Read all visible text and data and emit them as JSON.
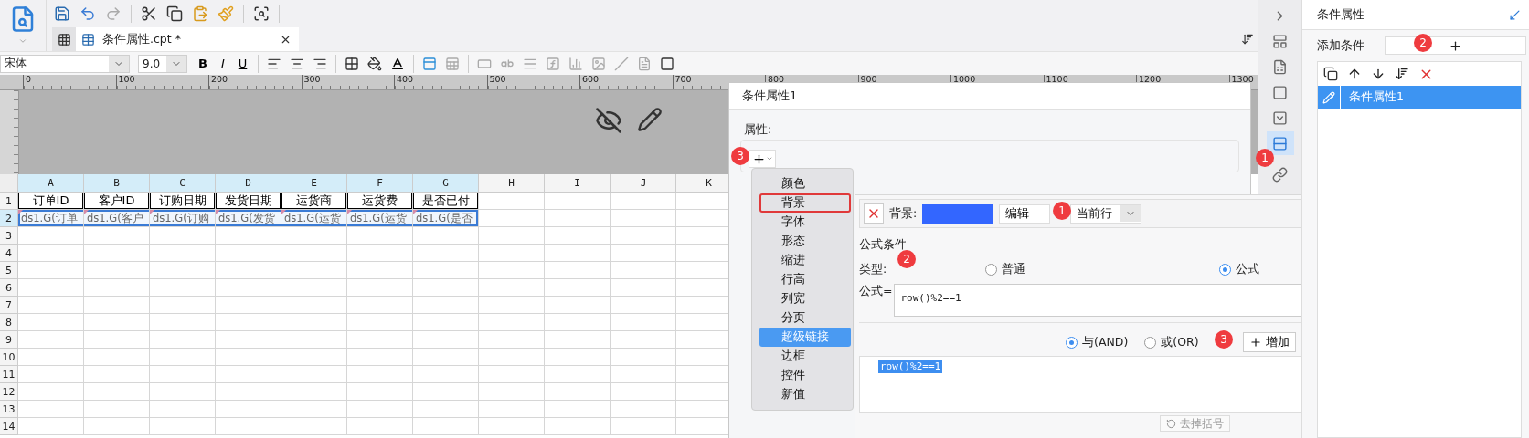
{
  "tab_bar": {
    "tabs": [
      {
        "label": "条件属性.cpt *",
        "selected": true
      }
    ]
  },
  "format_toolbar": {
    "font": "宋体",
    "size": "9.0",
    "style_buttons": [
      "B",
      "I",
      "U"
    ]
  },
  "ruler": {
    "labels": [
      "0",
      "100",
      "200",
      "300",
      "400",
      "500",
      "600",
      "700",
      "800",
      "900",
      "1000",
      "1100",
      "1200",
      "1300"
    ]
  },
  "sheet": {
    "columns": [
      {
        "label": "A",
        "selected": true,
        "page_break": false
      },
      {
        "label": "B",
        "selected": true,
        "page_break": false
      },
      {
        "label": "C",
        "selected": true,
        "page_break": false
      },
      {
        "label": "D",
        "selected": true,
        "page_break": false
      },
      {
        "label": "E",
        "selected": true,
        "page_break": false
      },
      {
        "label": "F",
        "selected": true,
        "page_break": false
      },
      {
        "label": "G",
        "selected": true,
        "page_break": false
      },
      {
        "label": "H",
        "selected": false,
        "page_break": false
      },
      {
        "label": "I",
        "selected": false,
        "page_break": false
      },
      {
        "label": "J",
        "selected": false,
        "page_break": true
      },
      {
        "label": "K",
        "selected": false,
        "page_break": false
      }
    ],
    "rows": [
      {
        "number": "1",
        "kind": "header",
        "selected": false,
        "cells": [
          "订单ID",
          "客户ID",
          "订购日期",
          "发货日期",
          "运货商",
          "运货费",
          "是否已付"
        ]
      },
      {
        "number": "2",
        "kind": "field",
        "selected": true,
        "cells": [
          "ds1.G(订单",
          "ds1.G(客户",
          "ds1.G(订购",
          "ds1.G(发货",
          "ds1.G(运货",
          "ds1.G(运货",
          "ds1.G(是否"
        ]
      },
      {
        "number": "3",
        "kind": "empty",
        "selected": false
      },
      {
        "number": "4",
        "kind": "empty",
        "selected": false
      },
      {
        "number": "5",
        "kind": "empty",
        "selected": false
      },
      {
        "number": "6",
        "kind": "empty",
        "selected": false
      },
      {
        "number": "7",
        "kind": "empty",
        "selected": false
      },
      {
        "number": "8",
        "kind": "empty",
        "selected": false
      },
      {
        "number": "9",
        "kind": "empty",
        "selected": false
      },
      {
        "number": "10",
        "kind": "empty",
        "selected": false
      },
      {
        "number": "11",
        "kind": "empty",
        "selected": false
      },
      {
        "number": "12",
        "kind": "empty",
        "selected": false
      },
      {
        "number": "13",
        "kind": "empty",
        "selected": false
      },
      {
        "number": "14",
        "kind": "empty",
        "selected": false
      }
    ]
  },
  "dialog": {
    "title": "条件属性1",
    "section_label": "属性:",
    "badge": "3"
  },
  "add_menu": {
    "items": [
      {
        "label": "颜色",
        "selected": false,
        "outlined": false
      },
      {
        "label": "背景",
        "selected": false,
        "outlined": true
      },
      {
        "label": "字体",
        "selected": false,
        "outlined": false
      },
      {
        "label": "形态",
        "selected": false,
        "outlined": false
      },
      {
        "label": "缩进",
        "selected": false,
        "outlined": false
      },
      {
        "label": "行高",
        "selected": false,
        "outlined": false
      },
      {
        "label": "列宽",
        "selected": false,
        "outlined": false
      },
      {
        "label": "分页",
        "selected": false,
        "outlined": false
      },
      {
        "label": "超级链接",
        "selected": true,
        "outlined": false
      },
      {
        "label": "边框",
        "selected": false,
        "outlined": false
      },
      {
        "label": "控件",
        "selected": false,
        "outlined": false
      },
      {
        "label": "新值",
        "selected": false,
        "outlined": false
      }
    ]
  },
  "condition_editor": {
    "label": "背景:",
    "color": "#3366ff",
    "edit_button": "编辑",
    "edit_badge": "1",
    "scope": "当前行",
    "section": "公式条件",
    "type_label": "类型:",
    "type_badge": "2",
    "types": [
      {
        "label": "普通",
        "selected": false
      },
      {
        "label": "公式",
        "selected": true
      }
    ],
    "formula_label": "公式=",
    "formula": "row()%2==1",
    "joins": [
      {
        "label": "与(AND)",
        "selected": true
      },
      {
        "label": "或(OR)",
        "selected": false
      }
    ],
    "add_badge": "3",
    "add_button": "增加",
    "conditions": [
      {
        "text": "row()%2==1",
        "selected": true
      }
    ],
    "remove_parens_button": "去掉括号"
  },
  "side_strip": {
    "badge": "1",
    "tools": [
      {
        "kind": "expand",
        "selected": false
      },
      {
        "kind": "layout",
        "selected": false
      },
      {
        "kind": "info",
        "selected": false
      },
      {
        "kind": "frame",
        "selected": false
      },
      {
        "kind": "dropdown",
        "selected": false
      },
      {
        "kind": "condition",
        "selected": true
      },
      {
        "kind": "link",
        "selected": false
      }
    ]
  },
  "right_panel": {
    "title": "条件属性",
    "add_label": "添加条件",
    "badge": "2",
    "conditions": [
      {
        "label": "条件属性1",
        "selected": true
      }
    ]
  }
}
